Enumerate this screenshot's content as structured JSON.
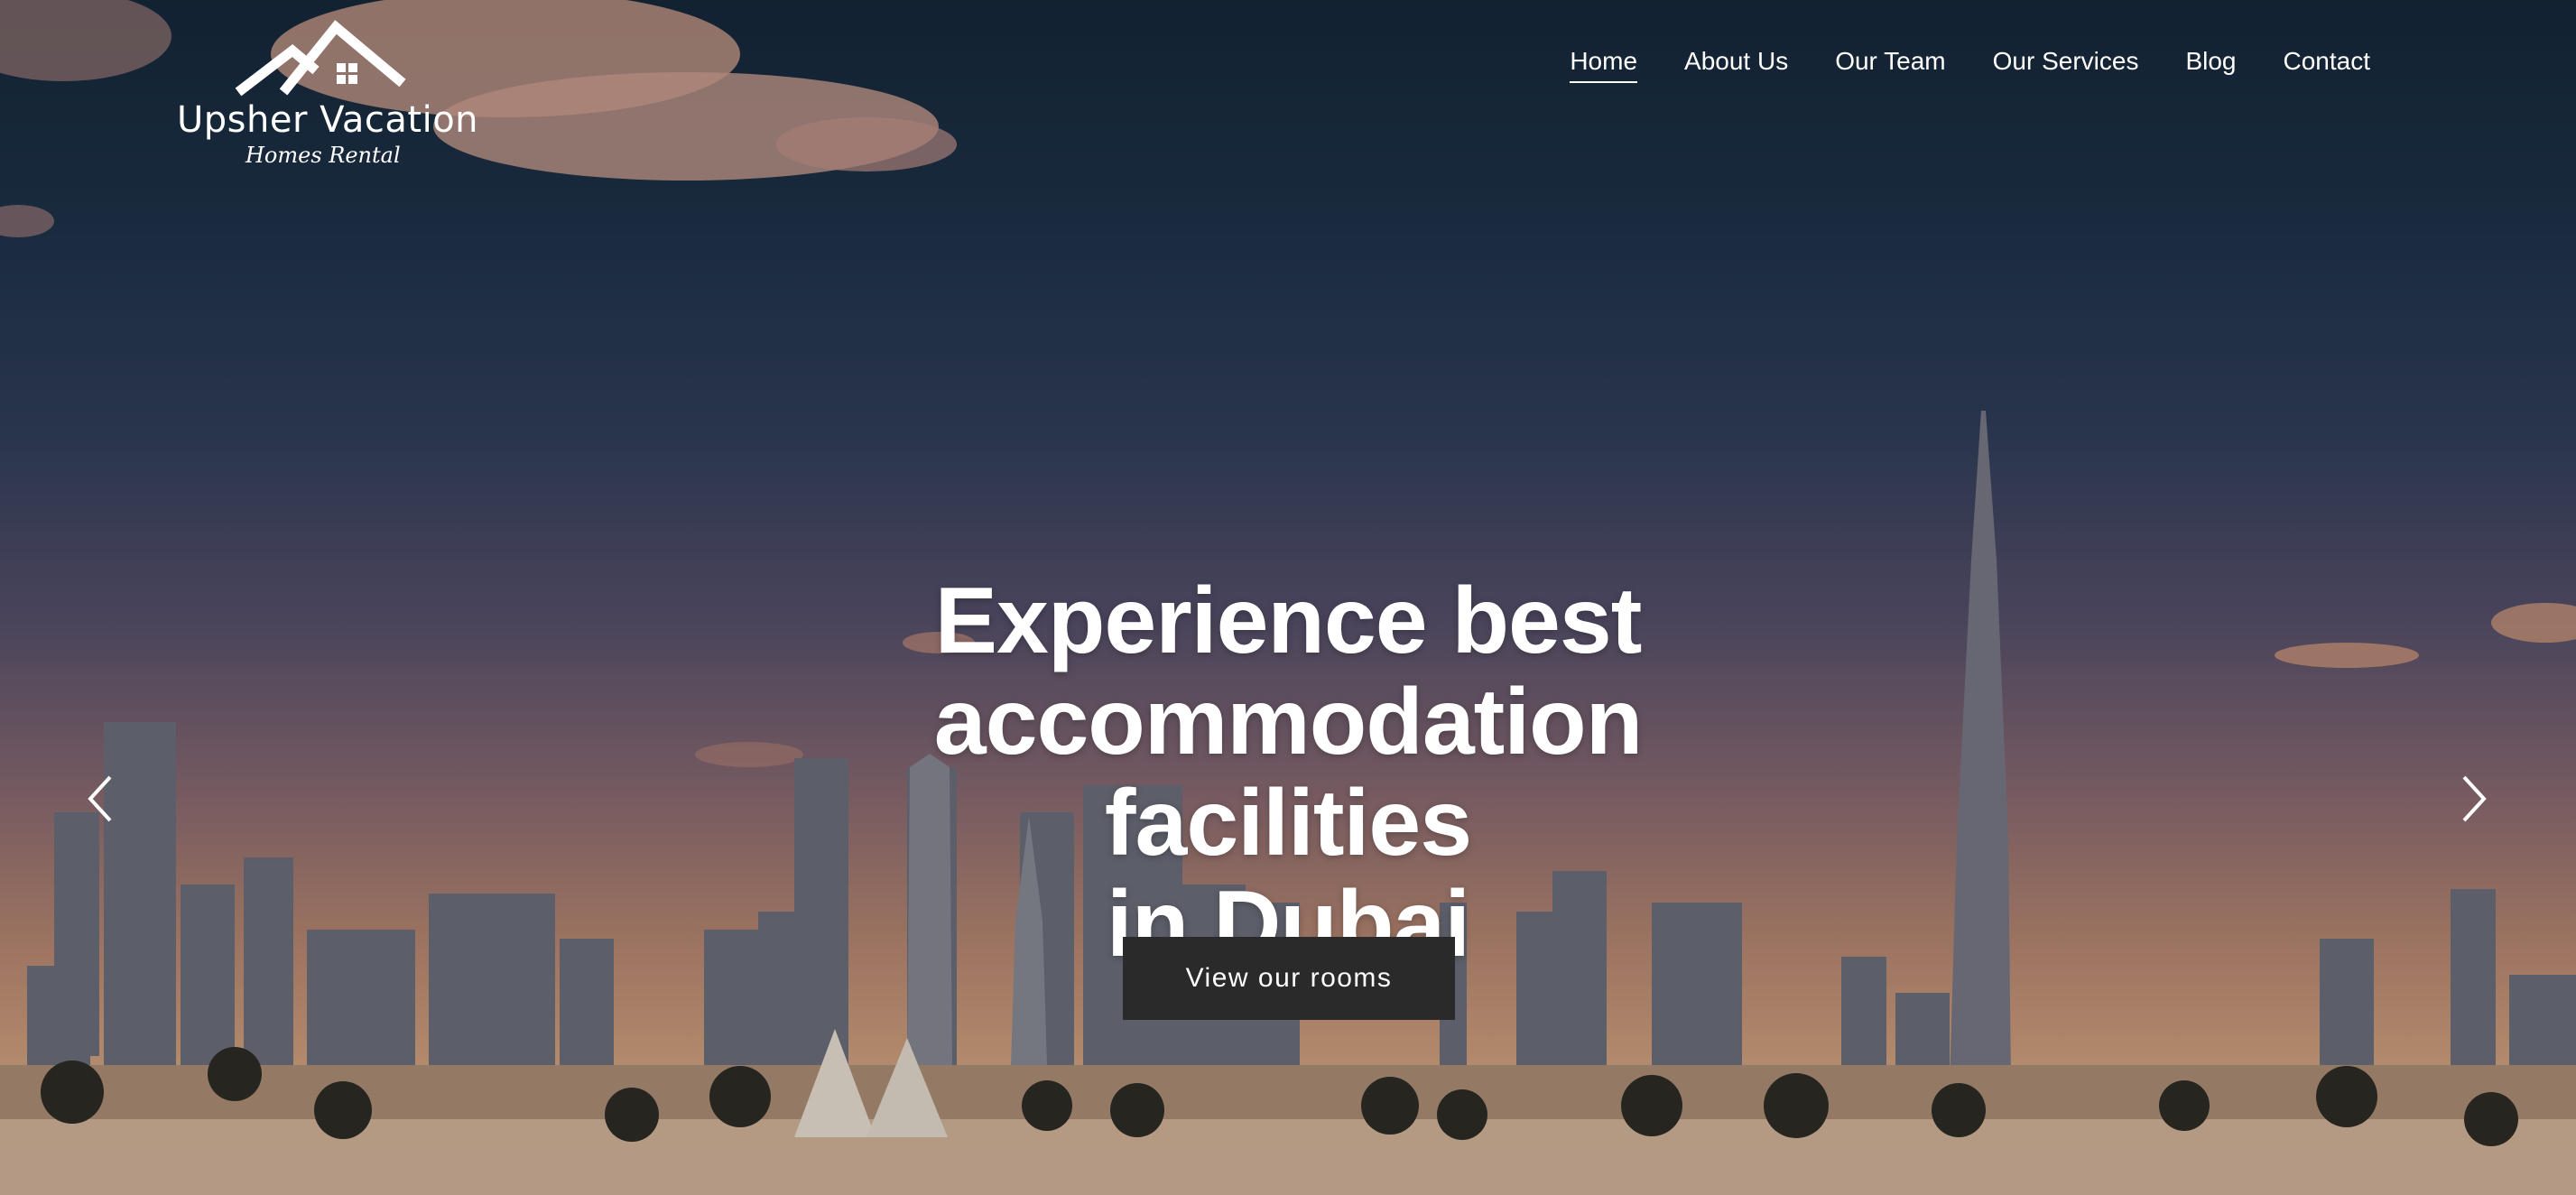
{
  "brand": {
    "name": "Upsher Vacation",
    "tagline": "Homes Rental"
  },
  "nav": {
    "items": [
      {
        "label": "Home",
        "active": true
      },
      {
        "label": "About Us",
        "active": false
      },
      {
        "label": "Our Team",
        "active": false
      },
      {
        "label": "Our Services",
        "active": false
      },
      {
        "label": "Blog",
        "active": false
      },
      {
        "label": "Contact",
        "active": false
      }
    ]
  },
  "hero": {
    "headline_line1": "Experience best",
    "headline_line2": "accommodation facilities",
    "headline_line3": "in Dubai",
    "cta_label": "View our rooms",
    "background_image": "dubai-skyline-photo",
    "prev_icon": "chevron-left-icon",
    "next_icon": "chevron-right-icon"
  },
  "colors": {
    "cta_background": "#2a2a2a",
    "text": "#ffffff"
  }
}
